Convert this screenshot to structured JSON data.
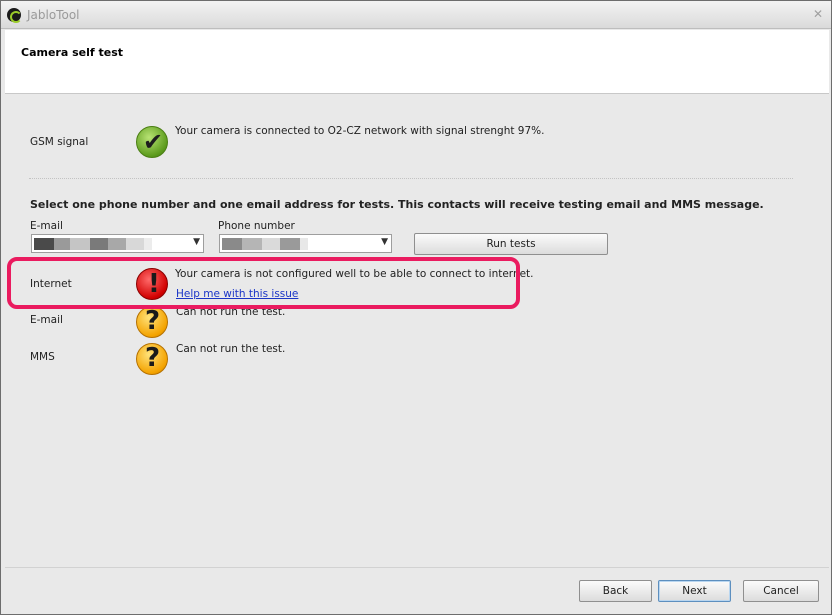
{
  "window": {
    "title": "JabloTool"
  },
  "header": {
    "title": "Camera self test"
  },
  "gsm": {
    "label": "GSM signal",
    "message": "Your camera is connected to O2-CZ network with signal strenght 97%.",
    "icon": "checkmark-icon"
  },
  "contacts": {
    "instruction": "Select one phone number and one email address for tests. This contacts will receive testing email and MMS message.",
    "email_label": "E-mail",
    "phone_label": "Phone number",
    "run_button": "Run tests"
  },
  "tests": {
    "internet": {
      "label": "Internet",
      "message": "Your camera is not configured well to be able to connect to internet.",
      "link": "Help me with this issue",
      "icon": "error-icon"
    },
    "email": {
      "label": "E-mail",
      "message": "Can not run the test.",
      "icon": "question-icon"
    },
    "mms": {
      "label": "MMS",
      "message": "Can not run the test.",
      "icon": "question-icon"
    }
  },
  "footer": {
    "back": "Back",
    "next": "Next",
    "cancel": "Cancel"
  },
  "colors": {
    "highlight": "#ea1b5f",
    "link": "#1a35c7"
  }
}
